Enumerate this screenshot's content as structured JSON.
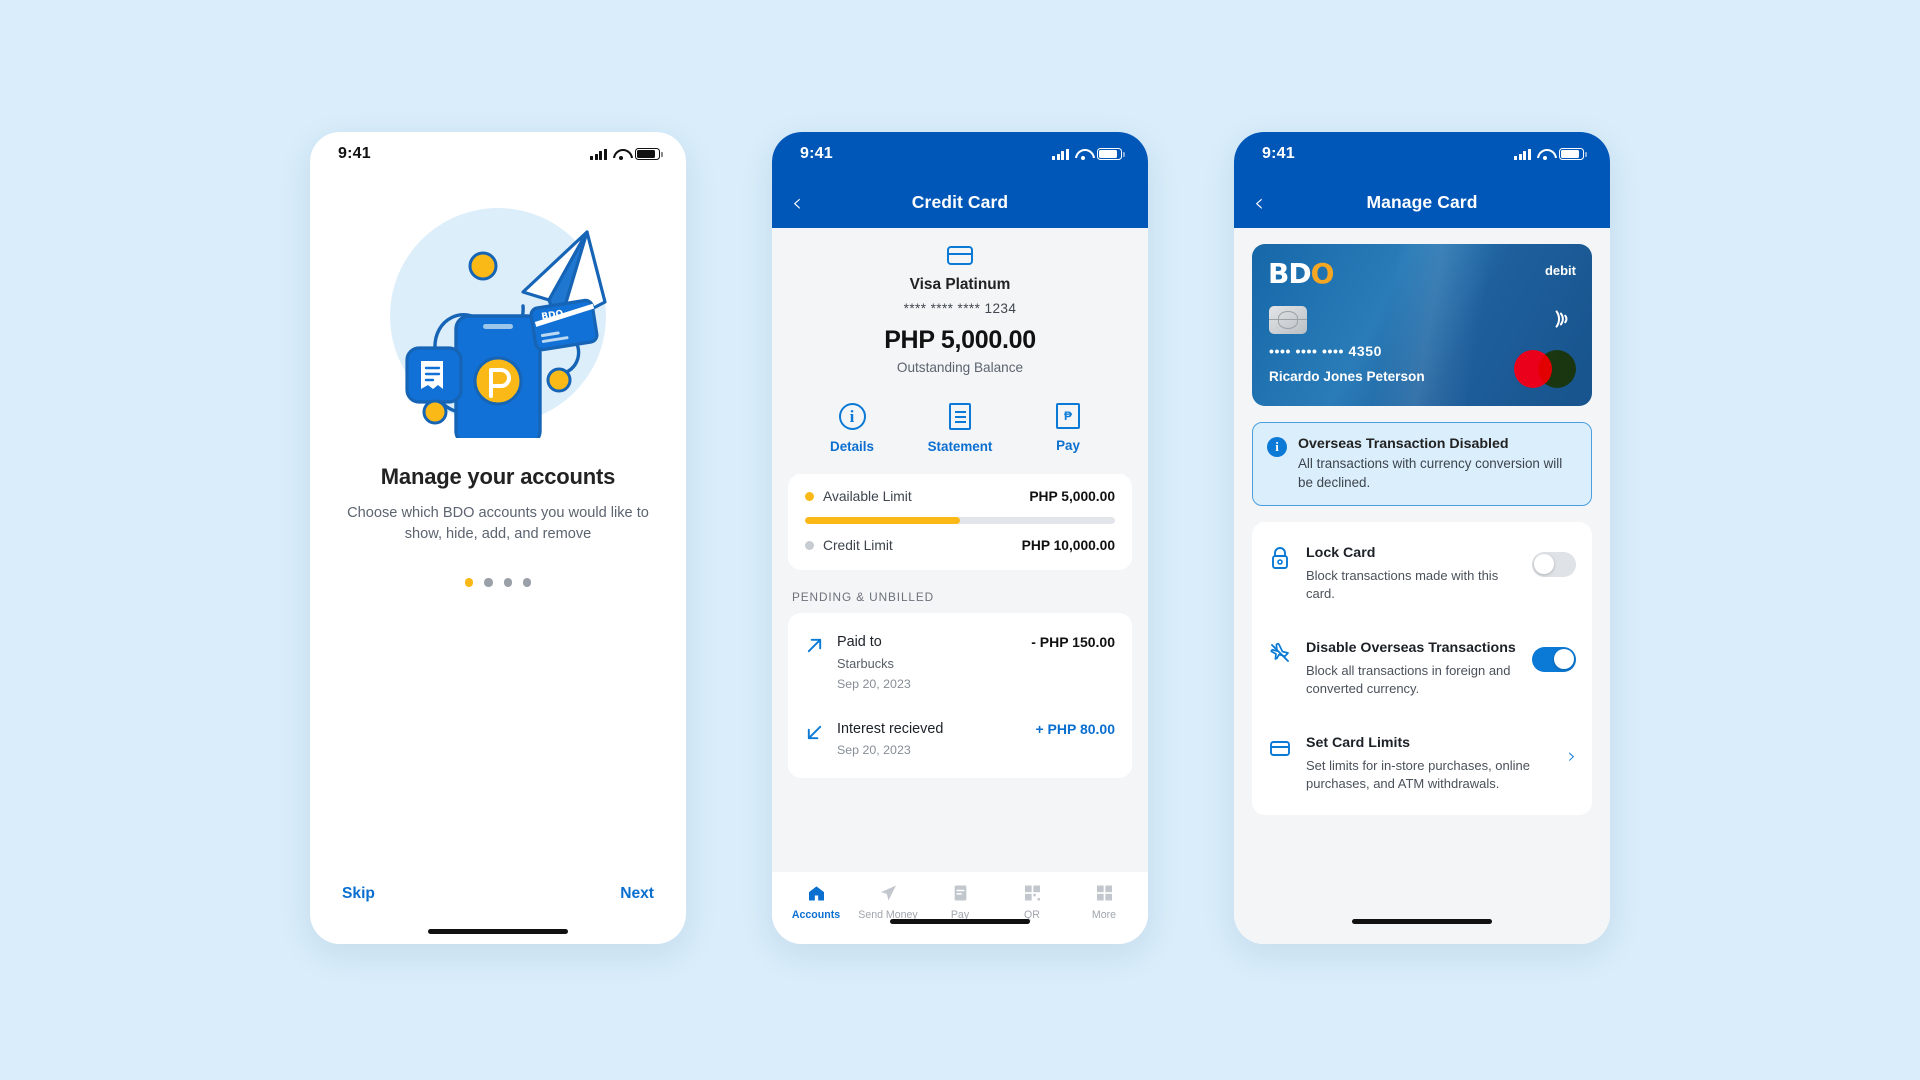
{
  "statusbar": {
    "time": "9:41"
  },
  "phone1": {
    "title": "Manage your accounts",
    "subtitle": "Choose which BDO accounts you would like to show, hide, add, and remove",
    "skip_label": "Skip",
    "next_label": "Next",
    "dots": {
      "count": 4,
      "active_index": 0,
      "active_color": "#fbb917",
      "inactive_color": "#9aa0a8"
    }
  },
  "phone2": {
    "nav": {
      "title": "Credit Card",
      "back_icon": "chevron-left-icon"
    },
    "card": {
      "icon": "credit-card-icon",
      "name": "Visa Platinum",
      "masked_number": "**** **** **** 1234",
      "amount": "PHP 5,000.00",
      "amount_label": "Outstanding Balance"
    },
    "actions": [
      {
        "label": "Details",
        "icon": "info-icon"
      },
      {
        "label": "Statement",
        "icon": "document-icon"
      },
      {
        "label": "Pay",
        "icon": "pay-icon"
      }
    ],
    "limits": [
      {
        "name": "Available Limit",
        "value": "PHP 5,000.00",
        "dot_color": "#fbb917"
      },
      {
        "name": "Credit Limit",
        "value": "PHP 10,000.00",
        "dot_color": "#c7ccd2"
      }
    ],
    "progress_percent": 50,
    "section_title": "PENDING & UNBILLED",
    "transactions": [
      {
        "title": "Paid to",
        "merchant": "Starbucks",
        "date": "Sep 20, 2023",
        "amount": "- PHP 150.00",
        "direction": "out"
      },
      {
        "title": "Interest recieved",
        "merchant": "",
        "date": "Sep 20, 2023",
        "amount": "+ PHP 80.00",
        "direction": "in"
      }
    ],
    "tabs": [
      {
        "label": "Accounts",
        "icon": "home-icon",
        "active": true
      },
      {
        "label": "Send Money",
        "icon": "paper-plane-icon",
        "active": false
      },
      {
        "label": "Pay",
        "icon": "bill-icon",
        "active": false
      },
      {
        "label": "QR",
        "icon": "qr-code-icon",
        "active": false
      },
      {
        "label": "More",
        "icon": "grid-icon",
        "active": false
      }
    ]
  },
  "phone3": {
    "nav": {
      "title": "Manage Card",
      "back_icon": "chevron-left-icon"
    },
    "card": {
      "brand": "BDO",
      "type": "debit",
      "masked_number": "•••• •••• •••• 4350",
      "holder": "Ricardo Jones Peterson",
      "chip_icon": "chip-icon",
      "contactless_icon": "contactless-icon",
      "network_icon": "mastercard-icon"
    },
    "banner": {
      "icon": "info-circle-icon",
      "title": "Overseas Transaction Disabled",
      "text": "All transactions with currency conversion will be declined."
    },
    "settings": [
      {
        "icon": "lock-icon",
        "title": "Lock Card",
        "subtitle": "Block transactions made with this card.",
        "control": "toggle",
        "on": false
      },
      {
        "icon": "airplane-off-icon",
        "title": "Disable Overseas Transactions",
        "subtitle": "Block all transactions in foreign and converted currency.",
        "control": "toggle",
        "on": true
      },
      {
        "icon": "card-limit-icon",
        "title": "Set Card Limits",
        "subtitle": "Set limits for in-store purchases, online purchases, and ATM withdrawals.",
        "control": "chevron",
        "chevron": "›"
      }
    ]
  },
  "colors": {
    "background": "#d9edfa",
    "brand_blue": "#0057b8",
    "accent_blue": "#0b7ad6",
    "link_blue": "#0b6fd0",
    "accent_yellow": "#fbb917",
    "panel_grey": "#f4f5f7"
  }
}
